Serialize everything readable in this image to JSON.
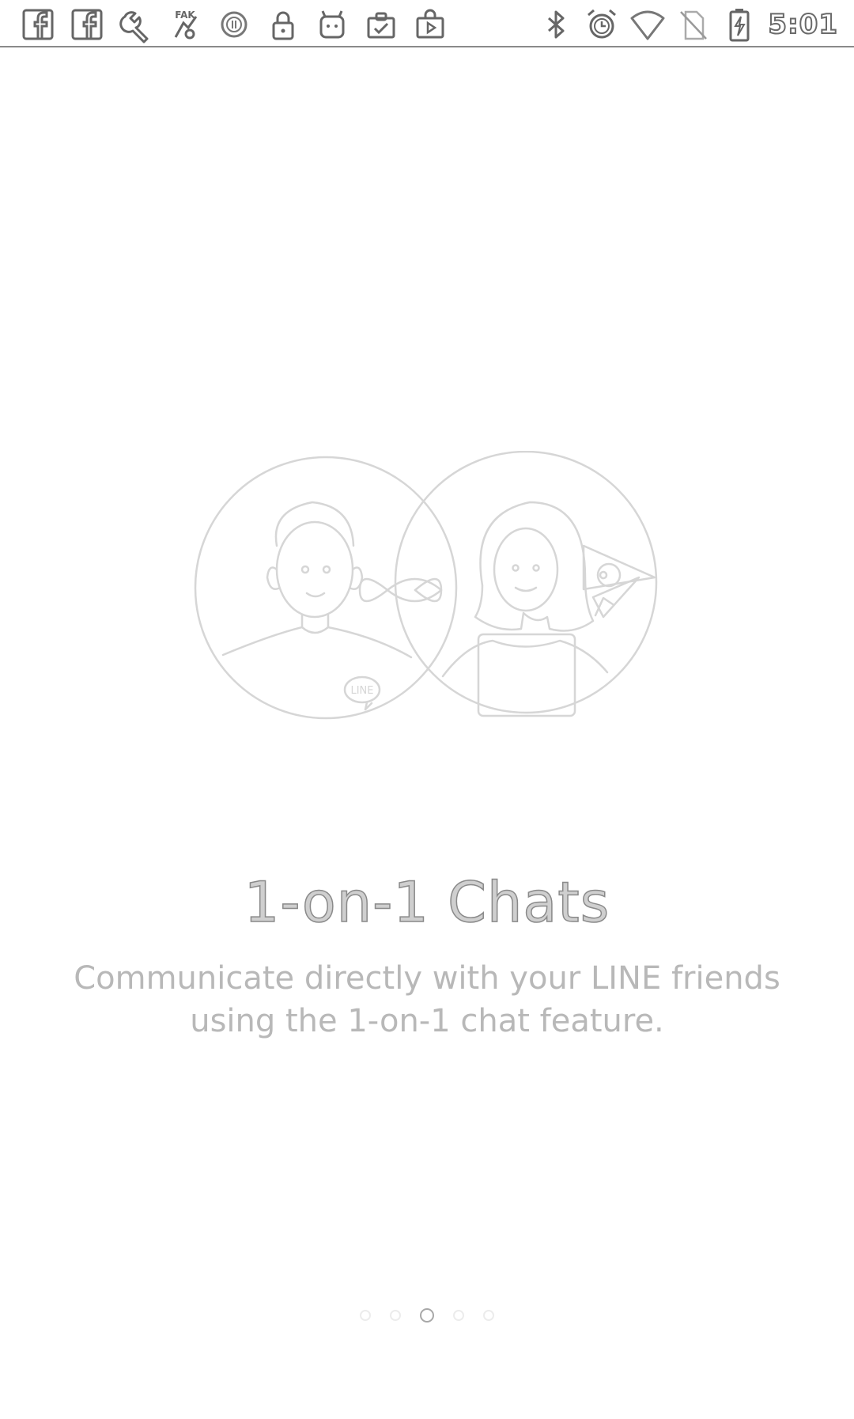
{
  "status_bar": {
    "notification_icons": [
      "facebook-icon",
      "facebook-icon",
      "wrench-icon",
      "fake-gps-icon",
      "circle-pause-icon",
      "lock-icon",
      "android-icon",
      "clipboard-check-icon",
      "play-store-icon"
    ],
    "system_icons": [
      "bluetooth-icon",
      "alarm-icon",
      "wifi-icon",
      "no-sim-icon",
      "battery-charging-icon"
    ],
    "time": "5:01"
  },
  "onboarding": {
    "illustration_badge": "LINE",
    "title": "1-on-1 Chats",
    "description": "Communicate directly with your LINE friends using the 1-on-1 chat feature.",
    "page_count": 5,
    "current_page": 3
  }
}
